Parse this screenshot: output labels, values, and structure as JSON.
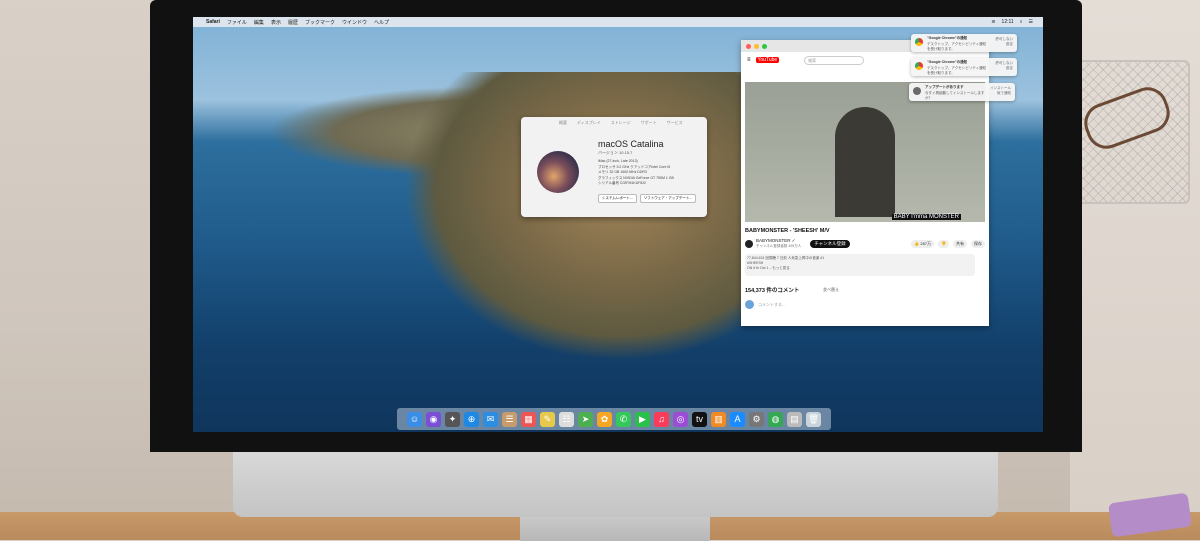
{
  "menubar": {
    "apple": "",
    "app": "Safari",
    "items": [
      "ファイル",
      "編集",
      "表示",
      "履歴",
      "ブックマーク",
      "ウインドウ",
      "ヘルプ"
    ],
    "clock": "12:11"
  },
  "about": {
    "tabs": [
      "概要",
      "ディスプレイ",
      "ストレージ",
      "サポート",
      "サービス"
    ],
    "title": "macOS Catalina",
    "version": "バージョン 10.15.7",
    "specs": [
      "iMac (27-inch, Late 2013)",
      "プロセッサ  3.2 GHz クアッドコアIntel Core i5",
      "メモリ  32 GB 1600 MHz DDR3",
      "グラフィックス  NVIDIA GeForce GT 755M 1 GB",
      "シリアル番号  C02FM1KUF8J2"
    ],
    "buttons": [
      "システムレポート...",
      "ソフトウェア・アップデート..."
    ]
  },
  "youtube": {
    "logo": "YouTube",
    "search_placeholder": "検索",
    "caption": "BABY I'mma MONSTER",
    "video_title": "BABYMONSTER - 'SHEESH' M/V",
    "channel": "BABYMONSTER ✓",
    "channel_sub": "チャンネル登録者数 495万人",
    "subscribe": "チャンネル登録",
    "actions": [
      "👍 287万",
      "👎",
      "共有",
      "保存"
    ],
    "description": "77,844,631 回視聴  7 日前  人気急上昇中の音楽 #1\n#SHEESH\nON 6 th Oct 1 ...もっと見る",
    "comments_count": "154,373 件のコメント",
    "sort": "並べ替え",
    "reply_placeholder": "コメントする..."
  },
  "notifications": [
    {
      "title": "\"Google Chrome\"の通知",
      "body": "デスクトップ、アクセシビリティ通知を受け取ります。",
      "actions": "許可しない\n設定"
    },
    {
      "title": "\"Google Chrome\"の通知",
      "body": "デスクトップ、アクセシビリティ通知を受け取ります。",
      "actions": "許可しない\n設定"
    },
    {
      "title": "アップデートがあります",
      "body": "今すぐ再起動してインストールしますか？",
      "actions": "インストール\n後で通知"
    }
  ],
  "dock": {
    "apps": [
      {
        "name": "finder-icon",
        "glyph": "☺",
        "color": "#3a8ee6"
      },
      {
        "name": "siri-icon",
        "glyph": "◉",
        "color": "#7a4fd6"
      },
      {
        "name": "launchpad-icon",
        "glyph": "✦",
        "color": "#555"
      },
      {
        "name": "safari-icon",
        "glyph": "⊕",
        "color": "#1e88e5"
      },
      {
        "name": "mail-icon",
        "glyph": "✉",
        "color": "#2d8de0"
      },
      {
        "name": "contacts-icon",
        "glyph": "☰",
        "color": "#c69c6d"
      },
      {
        "name": "calendar-icon",
        "glyph": "▦",
        "color": "#e55"
      },
      {
        "name": "notes-icon",
        "glyph": "✎",
        "color": "#e6c84a"
      },
      {
        "name": "reminders-icon",
        "glyph": "☷",
        "color": "#ddd"
      },
      {
        "name": "maps-icon",
        "glyph": "➤",
        "color": "#4caf50"
      },
      {
        "name": "photos-icon",
        "glyph": "✿",
        "color": "#f5a623"
      },
      {
        "name": "messages-icon",
        "glyph": "✆",
        "color": "#34c759"
      },
      {
        "name": "facetime-icon",
        "glyph": "▶",
        "color": "#2bbf4b"
      },
      {
        "name": "music-icon",
        "glyph": "♫",
        "color": "#fa3c5a"
      },
      {
        "name": "podcasts-icon",
        "glyph": "◎",
        "color": "#9b4dd6"
      },
      {
        "name": "tv-icon",
        "glyph": "tv",
        "color": "#111"
      },
      {
        "name": "books-icon",
        "glyph": "▥",
        "color": "#f08a24"
      },
      {
        "name": "appstore-icon",
        "glyph": "A",
        "color": "#1a8cff"
      },
      {
        "name": "preferences-icon",
        "glyph": "⚙",
        "color": "#777"
      },
      {
        "name": "chrome-icon",
        "glyph": "◍",
        "color": "#34a853"
      },
      {
        "name": "documents-icon",
        "glyph": "▤",
        "color": "#bbb"
      },
      {
        "name": "trash-icon",
        "glyph": "🗑",
        "color": "#c9d3db"
      }
    ]
  },
  "device": {
    "chin_logo": ""
  }
}
